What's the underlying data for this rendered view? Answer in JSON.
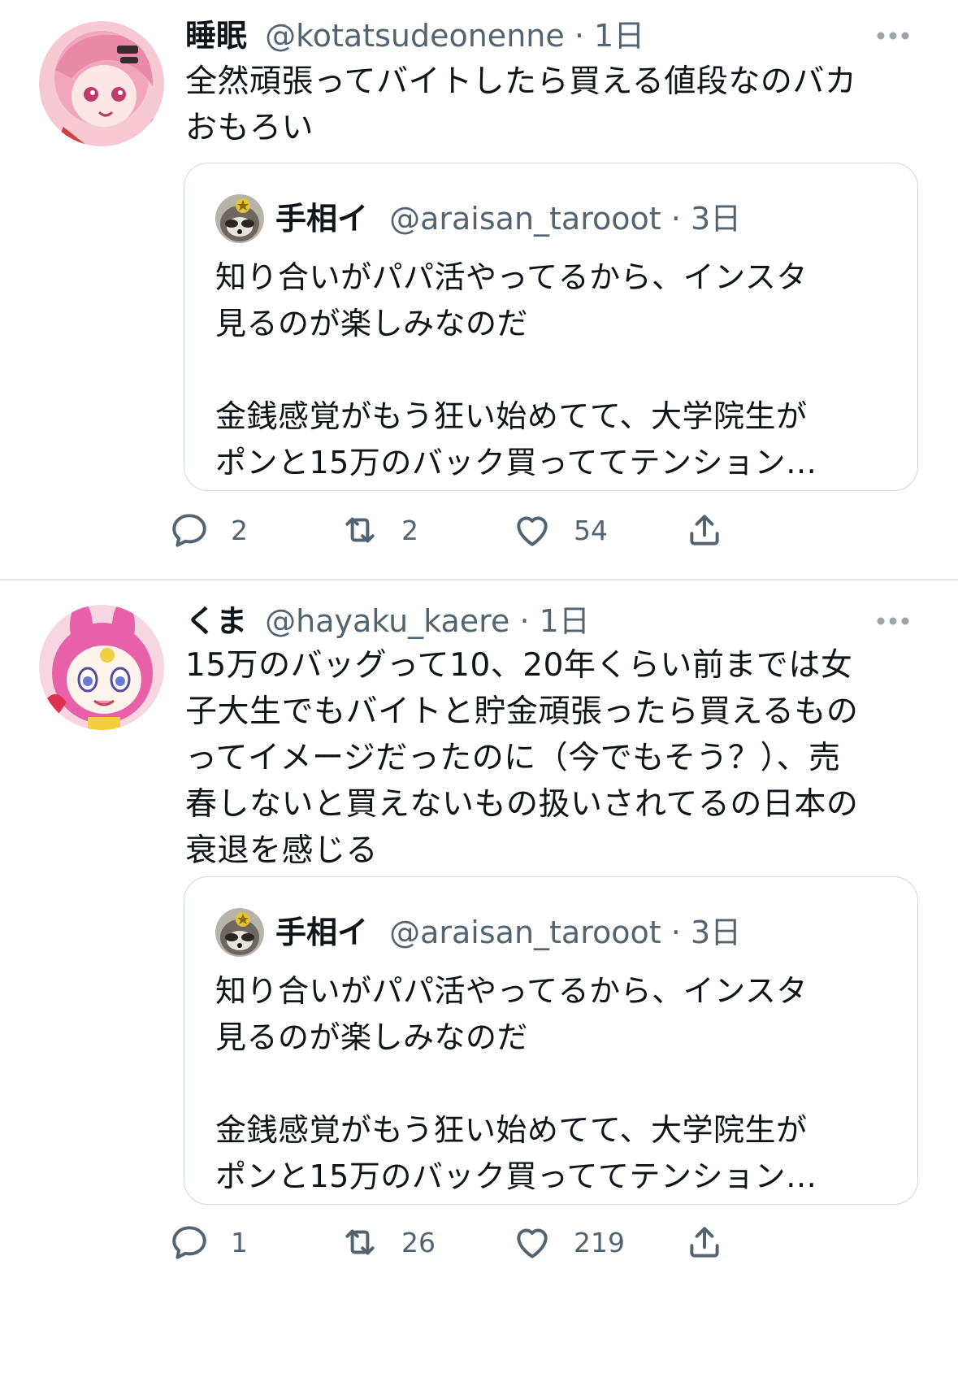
{
  "tweets": [
    {
      "display_name": "睡眠",
      "handle": "@kotatsudeonenne",
      "separator": "·",
      "time": "1日",
      "text": "全然頑張ってバイトしたら買える値段なのバカ\nおもろい",
      "quote": {
        "display_name": "手相イ",
        "handle": "@araisan_tarooot",
        "separator": "·",
        "time": "3日",
        "text": "知り合いがパパ活やってるから、インスタ\n見るのが楽しみなのだ\n\n金銭感覚がもう狂い始めてて、大学院生が\nポンと15万のバック買っててテンション…"
      },
      "actions": {
        "reply_count": "2",
        "retweet_count": "2",
        "like_count": "54"
      }
    },
    {
      "display_name": "くま",
      "handle": "@hayaku_kaere",
      "separator": "·",
      "time": "1日",
      "text": "15万のバッグって10、20年くらい前までは女\n子大生でもバイトと貯金頑張ったら買えるもの\nってイメージだったのに（今でもそう？）、売\n春しないと買えないもの扱いされてるの日本の\n衰退を感じる",
      "quote": {
        "display_name": "手相イ",
        "handle": "@araisan_tarooot",
        "separator": "·",
        "time": "3日",
        "text": "知り合いがパパ活やってるから、インスタ\n見るのが楽しみなのだ\n\n金銭感覚がもう狂い始めてて、大学院生が\nポンと15万のバック買っててテンション…"
      },
      "actions": {
        "reply_count": "1",
        "retweet_count": "26",
        "like_count": "219"
      }
    }
  ],
  "icons": {
    "reply": "reply-icon",
    "retweet": "retweet-icon",
    "like": "heart-icon",
    "share": "share-icon",
    "more": "more-icon"
  },
  "colors": {
    "text": "#0f1419",
    "secondary": "#536471",
    "border": "#cfd9de"
  }
}
